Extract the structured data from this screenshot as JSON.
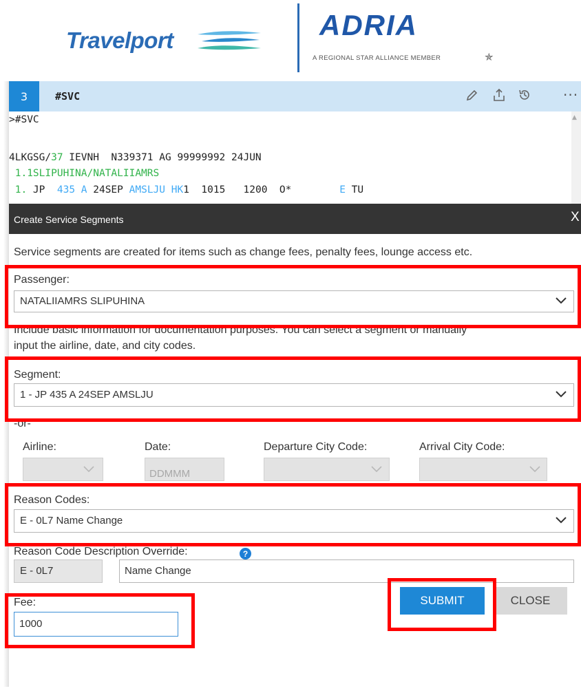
{
  "branding": {
    "travelport_name": "Travelport",
    "adria_name": "ADRIA",
    "adria_tagline": "A REGIONAL STAR ALLIANCE MEMBER",
    "star_icon": "star-alliance-icon"
  },
  "terminal": {
    "tab_number": "3",
    "tab_title": "#SVC",
    "header_icons": [
      "pencil-icon",
      "share-upload-icon",
      "history-icon",
      "more-icon"
    ],
    "line1": ">#SVC",
    "line2_a": "4LKGSG/",
    "line2_b": "37",
    "line2_c": " IEVNH  N339371 AG 99999992 24JUN",
    "line3": " 1.1SLIPUHINA/NATALIIAMRS",
    "line4_a": " 1.",
    "line4_b": " JP ",
    "line4_c": " 435 A",
    "line4_d": " 24SEP ",
    "line4_e": "AMSLJU HK",
    "line4_f": "1  1015   1200  O*        ",
    "line4_g": "E",
    "line4_h": " TU"
  },
  "dialog": {
    "title": "Create Service Segments",
    "close_glyph": "X",
    "intro": "Service segments are created for items such as change fees, penalty fees, lounge access etc.",
    "passenger_label": "Passenger:",
    "passenger_value": "NATALIIAMRS SLIPUHINA",
    "info_line1": "Include basic information for documentation purposes. You can select a segment or manually",
    "info_line2": "input the airline, date, and city codes.",
    "segment_label": "Segment:",
    "segment_value": "1 - JP 435 A 24SEP AMSLJU",
    "or_text": "-or-",
    "airline_label": "Airline:",
    "date_label": "Date:",
    "date_placeholder": "DDMMM",
    "departure_label": "Departure City Code:",
    "arrival_label": "Arrival City Code:",
    "reason_label": "Reason Codes:",
    "reason_value": "E - 0L7 Name Change",
    "override_label": "Reason Code Description Override:",
    "override_code": "E - 0L7",
    "override_desc": "Name Change",
    "fee_label": "Fee:",
    "fee_value": "1000",
    "submit_label": "SUBMIT",
    "close_label": "CLOSE"
  },
  "colors": {
    "accent_blue": "#1e88d6",
    "highlight_red": "#ff0000",
    "terminal_green": "#31b34a",
    "terminal_blue": "#3fa9f5"
  }
}
